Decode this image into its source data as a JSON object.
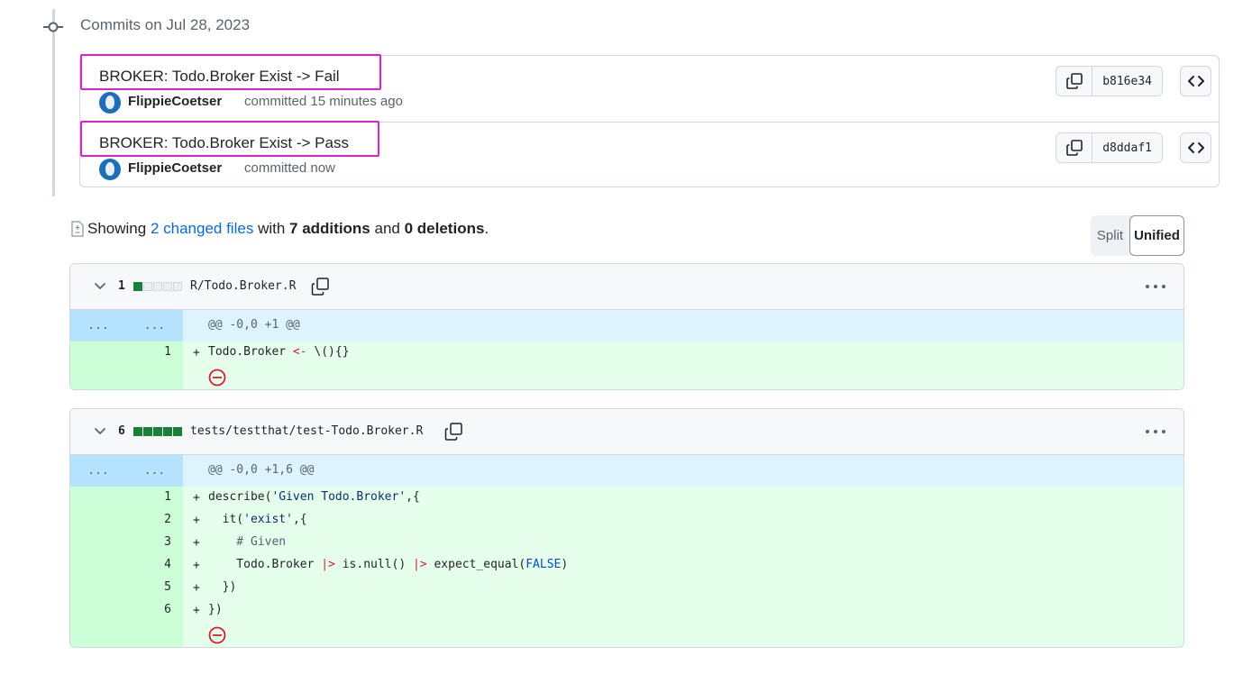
{
  "timeline": {
    "date_heading": "Commits on Jul 28, 2023"
  },
  "commits": [
    {
      "title": "BROKER: Todo.Broker Exist -> Fail",
      "author": "FlippieCoetser",
      "meta": "committed 15 minutes ago",
      "sha": "b816e34"
    },
    {
      "title": "BROKER: Todo.Broker Exist -> Pass",
      "author": "FlippieCoetser",
      "meta": "committed now",
      "sha": "d8ddaf1"
    }
  ],
  "summary": {
    "showing": "Showing",
    "changed_files": "2 changed files",
    "with": "with",
    "additions": "7 additions",
    "and": "and",
    "deletions": "0 deletions",
    "period": "."
  },
  "view_toggle": {
    "split": "Split",
    "unified": "Unified",
    "selected": "Unified"
  },
  "files": [
    {
      "count": "1",
      "name": "R/Todo.Broker.R",
      "diffstat": [
        "add",
        "neutral",
        "neutral",
        "neutral",
        "neutral"
      ],
      "hunk": {
        "left": "...",
        "right": "...",
        "header": "@@ -0,0 +1 @@"
      },
      "lines": [
        {
          "num": "1",
          "sign": "+",
          "parts": [
            [
              "",
              "Todo.Broker "
            ],
            [
              "op",
              "<-"
            ],
            [
              "",
              " \\(){}"
            ]
          ]
        }
      ]
    },
    {
      "count": "6",
      "name": "tests/testthat/test-Todo.Broker.R",
      "diffstat": [
        "add",
        "add",
        "add",
        "add",
        "add"
      ],
      "hunk": {
        "left": "...",
        "right": "...",
        "header": "@@ -0,0 +1,6 @@"
      },
      "lines": [
        {
          "num": "1",
          "sign": "+",
          "parts": [
            [
              "",
              "describe("
            ],
            [
              "str",
              "'Given Todo.Broker'"
            ],
            [
              "",
              ",{"
            ]
          ]
        },
        {
          "num": "2",
          "sign": "+",
          "parts": [
            [
              "",
              "  it("
            ],
            [
              "str",
              "'exist'"
            ],
            [
              "",
              ",{"
            ]
          ]
        },
        {
          "num": "3",
          "sign": "+",
          "parts": [
            [
              "com",
              "    # Given"
            ]
          ]
        },
        {
          "num": "4",
          "sign": "+",
          "parts": [
            [
              "",
              "    Todo.Broker "
            ],
            [
              "op",
              "|>"
            ],
            [
              "",
              " is.null() "
            ],
            [
              "op",
              "|>"
            ],
            [
              "",
              " expect_equal("
            ],
            [
              "const",
              "FALSE"
            ],
            [
              "",
              ")"
            ]
          ]
        },
        {
          "num": "5",
          "sign": "+",
          "parts": [
            [
              "",
              "  })"
            ]
          ]
        },
        {
          "num": "6",
          "sign": "+",
          "parts": [
            [
              "",
              "})"
            ]
          ]
        }
      ]
    }
  ],
  "colors": {
    "highlight_box": "#e020c8",
    "link": "#0969da",
    "addition_bg": "#e6ffec",
    "addition_gutter": "#ccffd8",
    "hunk_bg": "#ddf4ff",
    "diffstat_add": "#1a7f37"
  },
  "icons": [
    "git-commit-icon",
    "copy-icon",
    "code-browse-icon",
    "file-diff-icon",
    "chevron-down-icon",
    "kebab-horizontal-icon",
    "no-entry-icon"
  ]
}
